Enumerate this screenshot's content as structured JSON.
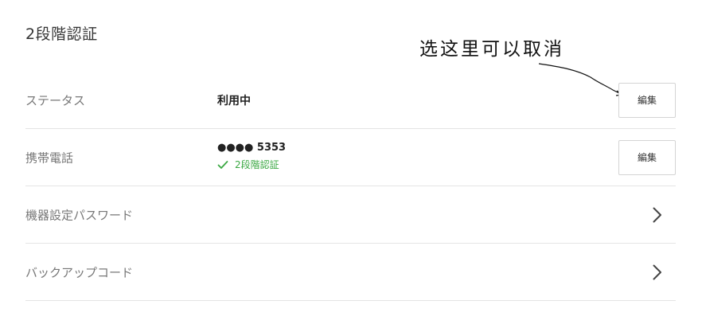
{
  "page": {
    "title": "2段階認証"
  },
  "annotation": {
    "text": "选这里可以取消"
  },
  "rows": {
    "status": {
      "label": "ステータス",
      "value": "利用中",
      "button_label": "編集"
    },
    "phone": {
      "label": "携帯電話",
      "number": "●●●● 5353",
      "badge": "2段階認証",
      "badge_color": "#3aa842",
      "button_label": "編集"
    },
    "device_password": {
      "label": "機器設定パスワード",
      "icon": "chevron-right-icon"
    },
    "backup_code": {
      "label": "バックアップコード",
      "icon": "chevron-right-icon"
    }
  }
}
